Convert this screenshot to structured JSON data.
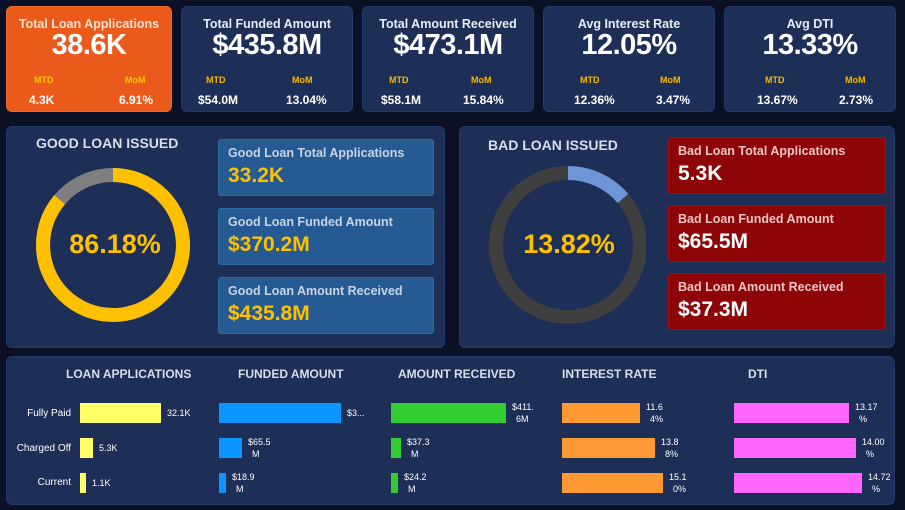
{
  "kpis": [
    {
      "title": "Total Loan Applications",
      "value": "38.6K",
      "mtd_label": "MTD",
      "mom_label": "MoM",
      "mtd": "4.3K",
      "mom": "6.91%"
    },
    {
      "title": "Total Funded Amount",
      "value": "$435.8M",
      "mtd_label": "MTD",
      "mom_label": "MoM",
      "mtd": "$54.0M",
      "mom": "13.04%"
    },
    {
      "title": "Total Amount Received",
      "value": "$473.1M",
      "mtd_label": "MTD",
      "mom_label": "MoM",
      "mtd": "$58.1M",
      "mom": "15.84%"
    },
    {
      "title": "Avg Interest Rate",
      "value": "12.05%",
      "mtd_label": "MTD",
      "mom_label": "MoM",
      "mtd": "12.36%",
      "mom": "3.47%"
    },
    {
      "title": "Avg DTI",
      "value": "13.33%",
      "mtd_label": "MTD",
      "mom_label": "MoM",
      "mtd": "13.67%",
      "mom": "2.73%"
    }
  ],
  "good": {
    "title": "GOOD LOAN ISSUED",
    "percent_label": "86.18%",
    "percent": 86.18,
    "ring_color": "#ffc000",
    "rest_color": "#7f7f7f",
    "boxes": [
      {
        "label": "Good Loan Total Applications",
        "value": "33.2K"
      },
      {
        "label": "Good Loan Funded Amount",
        "value": "$370.2M"
      },
      {
        "label": "Good Loan Amount Received",
        "value": "$435.8M"
      }
    ]
  },
  "bad": {
    "title": "BAD LOAN ISSUED",
    "percent_label": "13.82%",
    "percent": 13.82,
    "ring_color": "#6e95d6",
    "rest_color": "#3f3f3f",
    "boxes": [
      {
        "label": "Bad Loan Total Applications",
        "value": "5.3K"
      },
      {
        "label": "Bad Loan Funded Amount",
        "value": "$65.5M"
      },
      {
        "label": "Bad Loan Amount Received",
        "value": "$37.3M"
      }
    ]
  },
  "status_table": {
    "rows": [
      "Fully Paid",
      "Charged Off",
      "Current"
    ],
    "columns": [
      {
        "header": "LOAN APPLICATIONS",
        "color": "#ffff66",
        "values": [
          32145,
          5333,
          1098
        ],
        "labels": [
          [
            "32.1K"
          ],
          [
            "5.3K"
          ],
          [
            "1.1K"
          ]
        ]
      },
      {
        "header": "FUNDED AMOUNT",
        "color": "#0b96ff",
        "values": [
          351.4,
          65.5,
          18.9
        ],
        "labels": [
          [
            "$3..."
          ],
          [
            "$65.5",
            "M"
          ],
          [
            "$18.9",
            "M"
          ]
        ]
      },
      {
        "header": "AMOUNT RECEIVED",
        "color": "#33cc33",
        "values": [
          411.6,
          37.3,
          24.2
        ],
        "labels": [
          [
            "$411.",
            "6M"
          ],
          [
            "$37.3",
            "M"
          ],
          [
            "$24.2",
            "M"
          ]
        ]
      },
      {
        "header": "INTEREST RATE",
        "color": "#ff9933",
        "values": [
          11.64,
          13.88,
          15.1
        ],
        "labels": [
          [
            "11.6",
            "4%"
          ],
          [
            "13.8",
            "8%"
          ],
          [
            "15.1",
            "0%"
          ]
        ]
      },
      {
        "header": "DTI",
        "color": "#ff66ff",
        "values": [
          13.17,
          14.0,
          14.72
        ],
        "labels": [
          [
            "13.17",
            "%"
          ],
          [
            "14.00",
            "%"
          ],
          [
            "14.72",
            "%"
          ]
        ]
      }
    ]
  }
}
